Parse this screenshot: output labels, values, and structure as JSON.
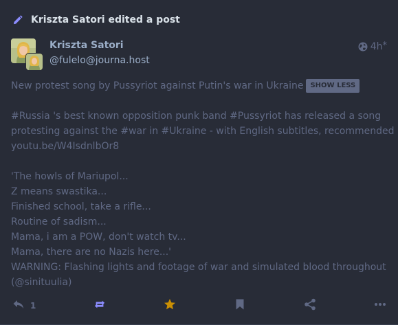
{
  "prepend": {
    "text": "Kriszta Satori edited a post",
    "icon": "pencil-icon",
    "icon_color": "#8c8dff"
  },
  "author": {
    "display_name": "Kriszta Satori",
    "acct": "@fulelo@journa.host"
  },
  "meta": {
    "visibility_icon": "globe-icon",
    "time": "4h",
    "edited_mark": "*"
  },
  "content": {
    "spoiler_text": "New protest song by Pussyriot against Putin's war in Ukraine",
    "show_less_label": "SHOW LESS",
    "paragraph1": [
      "#Russia 's best known opposition punk band #Pussyriot has released a song",
      "protesting against the #war in #Ukraine - with English subtitles, recommended",
      "youtu.be/W4IsdnlbOr8"
    ],
    "paragraph2": [
      "'The howls of Mariupol...",
      "Z means swastika...",
      "Finished school, take a rifle...",
      "Routine of sadism...",
      "Mama, i am a POW, don't watch tv...",
      "Mama, there are no Nazis here...'",
      "WARNING: Flashing lights and footage of war and simulated blood throughout",
      "(@sinituulia)"
    ]
  },
  "actions": {
    "reply_count": "1",
    "reply_icon": "reply-icon",
    "boost_icon": "boost-icon",
    "favourite_icon": "star-icon",
    "bookmark_icon": "bookmark-icon",
    "share_icon": "share-icon",
    "more_icon": "ellipsis-icon",
    "boost_color": "#8c8dff",
    "favourite_color": "#ca8f04",
    "muted_color": "#606984"
  },
  "colors": {
    "background": "#282c37",
    "text_muted": "#606984",
    "name_text": "#9baec8",
    "prepend_text": "#d9e1e8"
  }
}
